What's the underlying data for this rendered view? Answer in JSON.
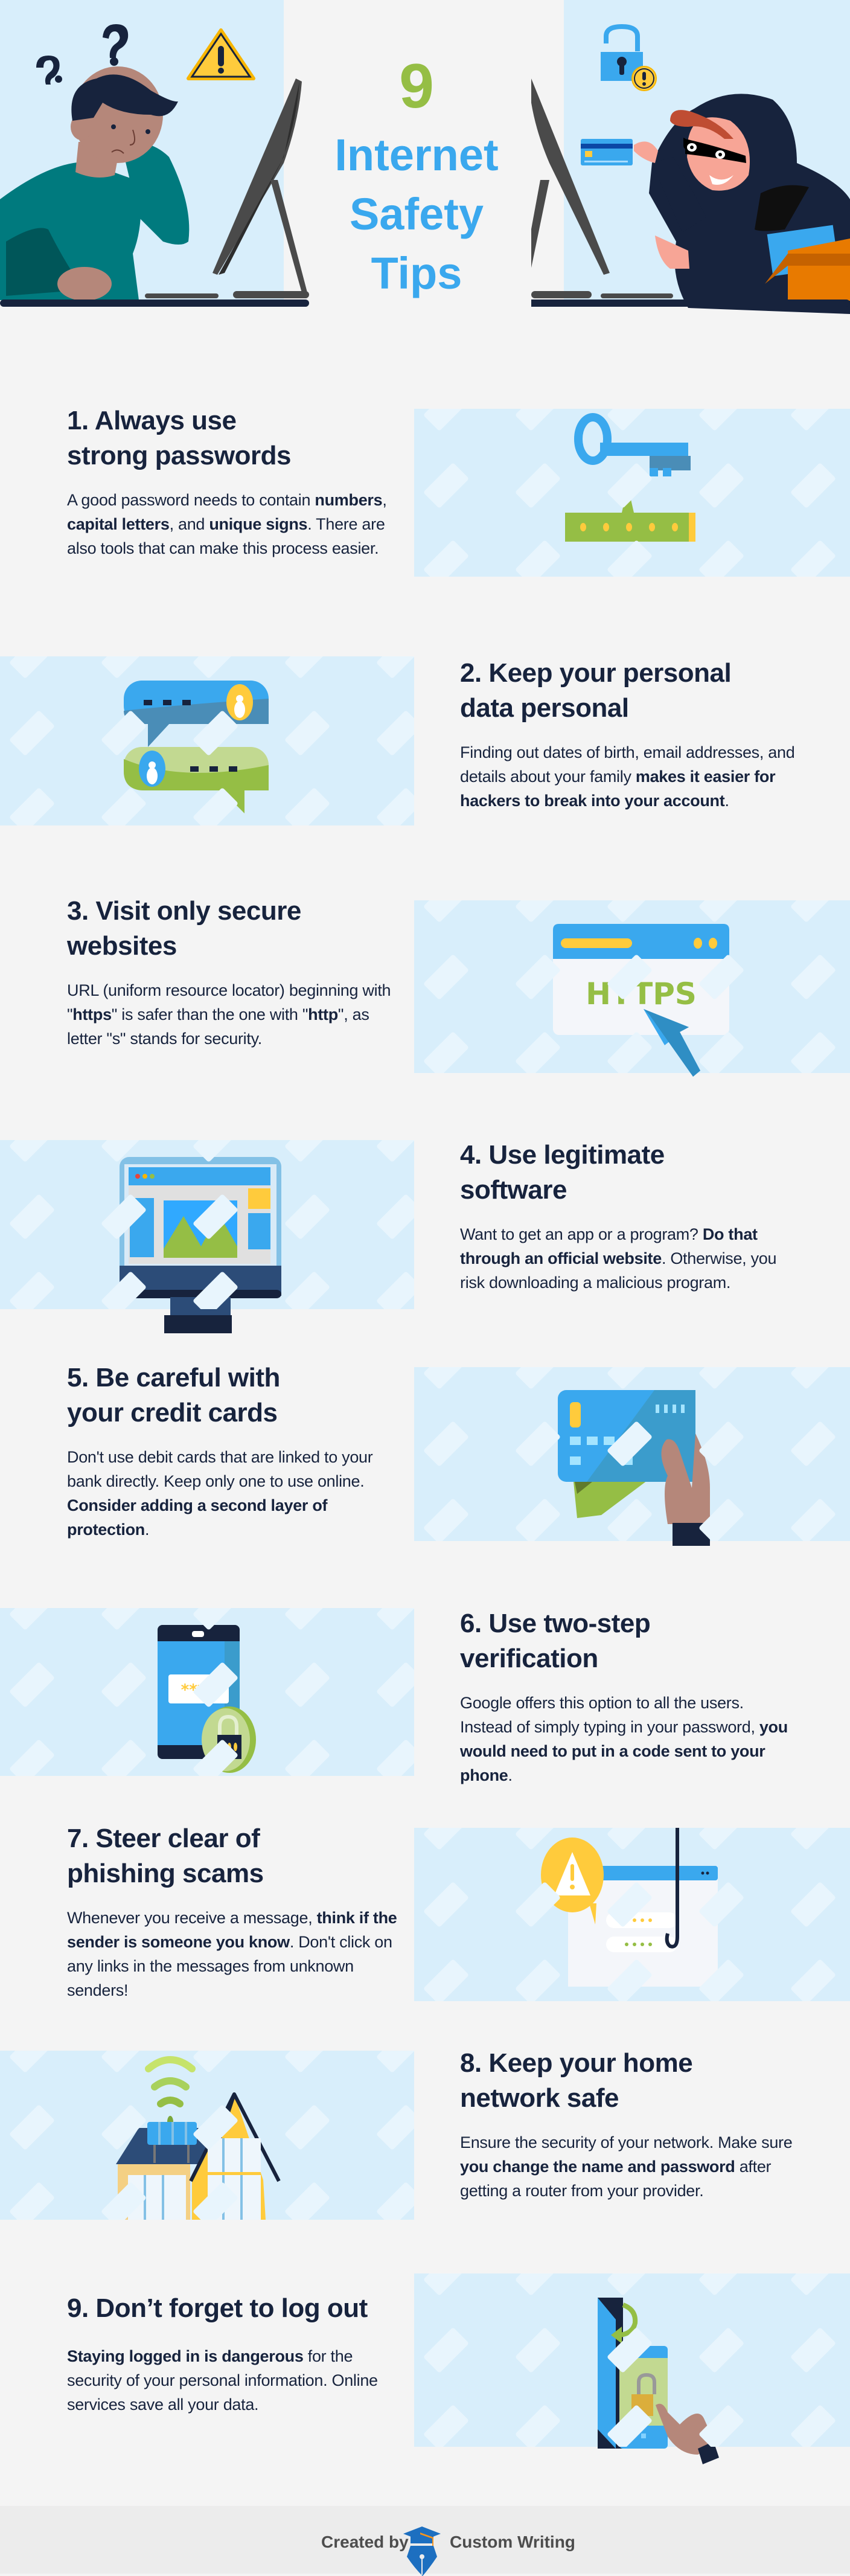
{
  "header": {
    "number": "9",
    "title_lines": [
      "Internet",
      "Safety",
      "Tips"
    ],
    "colors": {
      "number": "#95be45",
      "title": "#3aa8ee",
      "panel": "#d8eefb",
      "navy": "#17233d"
    }
  },
  "tips": [
    {
      "heading_lines": [
        "1. Always use",
        "strong passwords"
      ],
      "body": [
        {
          "t": "A good password needs to contain ",
          "b": false
        },
        {
          "t": "numbers",
          "b": true
        },
        {
          "t": ", ",
          "b": false
        },
        {
          "t": "capital letters",
          "b": true
        },
        {
          "t": ", and ",
          "b": false
        },
        {
          "t": "unique signs",
          "b": true
        },
        {
          "t": ". There are also tools that can make this process easier.",
          "b": false
        }
      ],
      "illustration": "key-and-password-field"
    },
    {
      "heading_lines": [
        "2. Keep your personal",
        "data personal"
      ],
      "body": [
        {
          "t": "Finding out dates of birth, email addresses, and details about your family ",
          "b": false
        },
        {
          "t": "makes it easier for hackers to break into your account",
          "b": true
        },
        {
          "t": ".",
          "b": false
        }
      ],
      "illustration": "chat-bubbles"
    },
    {
      "heading_lines": [
        "3. Visit only secure",
        "websites"
      ],
      "body": [
        {
          "t": "URL (uniform resource locator) beginning with \"",
          "b": false
        },
        {
          "t": "https",
          "b": true
        },
        {
          "t": "\" is safer than the one with \"",
          "b": false
        },
        {
          "t": "http",
          "b": true
        },
        {
          "t": "\", as letter \"s\" stands for security.",
          "b": false
        }
      ],
      "illustration": "https-browser",
      "illustration_text": "HTTPS"
    },
    {
      "heading_lines": [
        "4. Use legitimate",
        "software"
      ],
      "body": [
        {
          "t": "Want to get an app or a program? ",
          "b": false
        },
        {
          "t": "Do that through an official website",
          "b": true
        },
        {
          "t": ". Otherwise, you risk downloading a malicious program.",
          "b": false
        }
      ],
      "illustration": "desktop-monitor"
    },
    {
      "heading_lines": [
        "5. Be careful with",
        "your credit cards"
      ],
      "body": [
        {
          "t": "Don't use debit cards that are linked to your bank directly. Keep only one to use online. ",
          "b": false
        },
        {
          "t": "Consider adding a second layer of protection",
          "b": true
        },
        {
          "t": ".",
          "b": false
        }
      ],
      "illustration": "hand-holding-cards"
    },
    {
      "heading_lines": [
        "6. Use two-step",
        "verification"
      ],
      "body": [
        {
          "t": "Google offers this option to all the users. Instead of simply typing in your password, ",
          "b": false
        },
        {
          "t": "you would need to put in a code sent to your phone",
          "b": true
        },
        {
          "t": ".",
          "b": false
        }
      ],
      "illustration": "phone-with-lock",
      "illustration_text": "***"
    },
    {
      "heading_lines": [
        "7. Steer clear of",
        "phishing scams"
      ],
      "body": [
        {
          "t": "Whenever you receive a message, ",
          "b": false
        },
        {
          "t": "think if the sender is someone you know",
          "b": true
        },
        {
          "t": ". Don't click on any links in the messages from unknown senders!",
          "b": false
        }
      ],
      "illustration": "phishing-hook"
    },
    {
      "heading_lines": [
        "8. Keep your home",
        "network safe"
      ],
      "body": [
        {
          "t": "Ensure the security of your network. Make sure ",
          "b": false
        },
        {
          "t": "you change the name and password",
          "b": true
        },
        {
          "t": " after getting a router from your provider.",
          "b": false
        }
      ],
      "illustration": "house-with-router"
    },
    {
      "heading_lines": [
        "9. Don’t forget to log out"
      ],
      "body": [
        {
          "t": "Staying logged in is dangerous",
          "b": true
        },
        {
          "t": " for the security of your personal information. Online services save all your data.",
          "b": false
        }
      ],
      "illustration": "door-and-phone-logout"
    }
  ],
  "footer": {
    "created_by": "Created by",
    "brand": "Custom Writing",
    "logo_icon": "graduation-cap-pen-icon"
  }
}
